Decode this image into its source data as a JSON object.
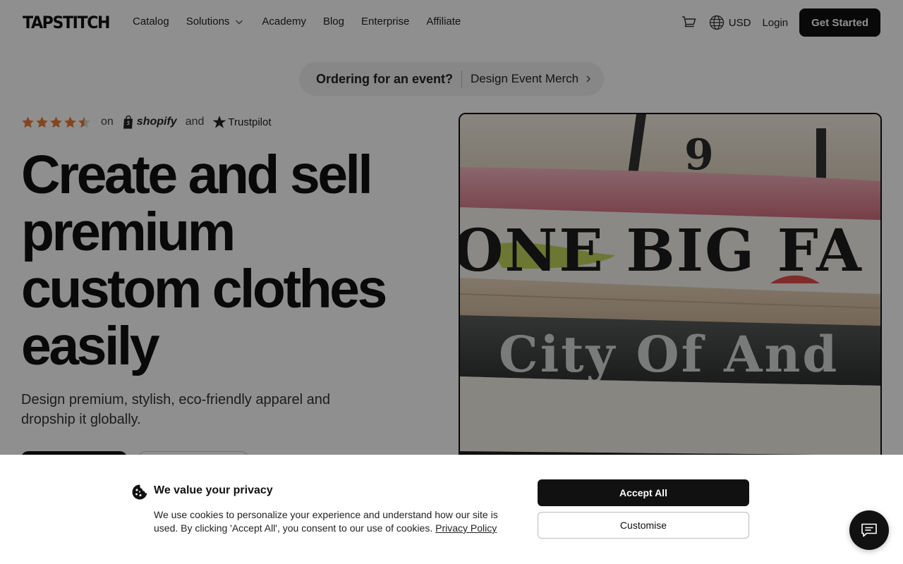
{
  "header": {
    "logo": "TAPSTITCH",
    "nav": [
      {
        "label": "Catalog"
      },
      {
        "label": "Solutions",
        "has_dropdown": true
      },
      {
        "label": "Academy"
      },
      {
        "label": "Blog"
      },
      {
        "label": "Enterprise"
      },
      {
        "label": "Affiliate"
      }
    ],
    "currency": "USD",
    "login": "Login",
    "get_started": "Get Started"
  },
  "event_banner": {
    "question": "Ordering for an event?",
    "link": "Design Event Merch"
  },
  "rating": {
    "stars": 4.5,
    "on": "on",
    "shopify": "shopify",
    "and": "and",
    "trustpilot": "Trustpilot"
  },
  "hero": {
    "title_lines": [
      "Create and sell",
      "premium",
      "custom clothes",
      "easily"
    ],
    "subtitle": "Design premium, stylish, eco-friendly apparel and dropship it globally.",
    "image_text": {
      "number": "9",
      "line1": "ONE BIG FA",
      "line2": "City Of And"
    }
  },
  "cookie": {
    "title": "We value your privacy",
    "text": "We use cookies to personalize your experience and understand how our site is used. By clicking 'Accept All', you consent to our use of cookies.",
    "policy_link": "Privacy Policy",
    "accept": "Accept All",
    "customise": "Customise"
  },
  "colors": {
    "primary": "#111111",
    "star": "#e87d3e",
    "overlay": "rgba(0,0,0,0.44)"
  },
  "icons": [
    "cart-icon",
    "globe-icon",
    "chevron-down-icon",
    "chevron-right-icon",
    "star-icon",
    "shopify-bag-icon",
    "trustpilot-star-icon",
    "cookie-icon",
    "chat-icon"
  ]
}
